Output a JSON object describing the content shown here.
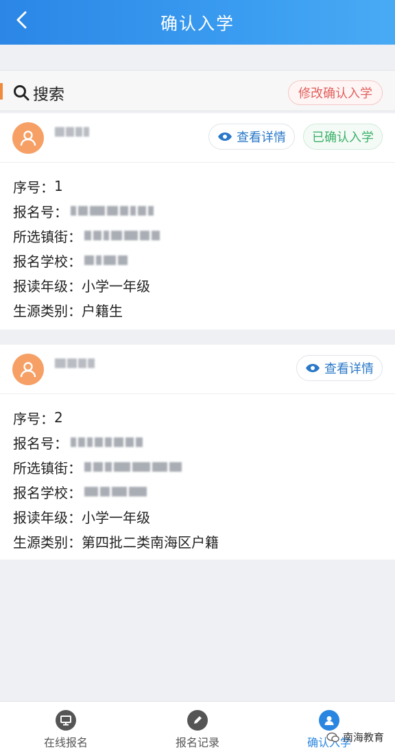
{
  "header": {
    "title": "确认入学"
  },
  "search": {
    "label": "搜索",
    "modify_button": "修改确认入学"
  },
  "cards": [
    {
      "view_button": "查看详情",
      "status_badge": "已确认入学",
      "fields": [
        {
          "label": "序号：",
          "value": "1"
        },
        {
          "label": "报名号：",
          "value": ""
        },
        {
          "label": "所选镇街：",
          "value": ""
        },
        {
          "label": "报名学校：",
          "value": ""
        },
        {
          "label": "报读年级：",
          "value": "小学一年级"
        },
        {
          "label": "生源类别：",
          "value": "户籍生"
        }
      ]
    },
    {
      "view_button": "查看详情",
      "fields": [
        {
          "label": "序号：",
          "value": "2"
        },
        {
          "label": "报名号：",
          "value": ""
        },
        {
          "label": "所选镇街：",
          "value": ""
        },
        {
          "label": "报名学校：",
          "value": ""
        },
        {
          "label": "报读年级：",
          "value": "小学一年级"
        },
        {
          "label": "生源类别：",
          "value": "第四批二类南海区户籍"
        }
      ]
    }
  ],
  "nav": [
    {
      "label": "在线报名",
      "icon": "monitor-icon"
    },
    {
      "label": "报名记录",
      "icon": "pencil-icon"
    },
    {
      "label": "确认入学",
      "icon": "user-icon"
    }
  ],
  "watermark": {
    "text": "南海教育"
  },
  "colors": {
    "header": "#2b86e6",
    "accent": "#f08a3c",
    "danger": "#e0605c",
    "success": "#3cb06a",
    "link": "#2a78c8"
  }
}
